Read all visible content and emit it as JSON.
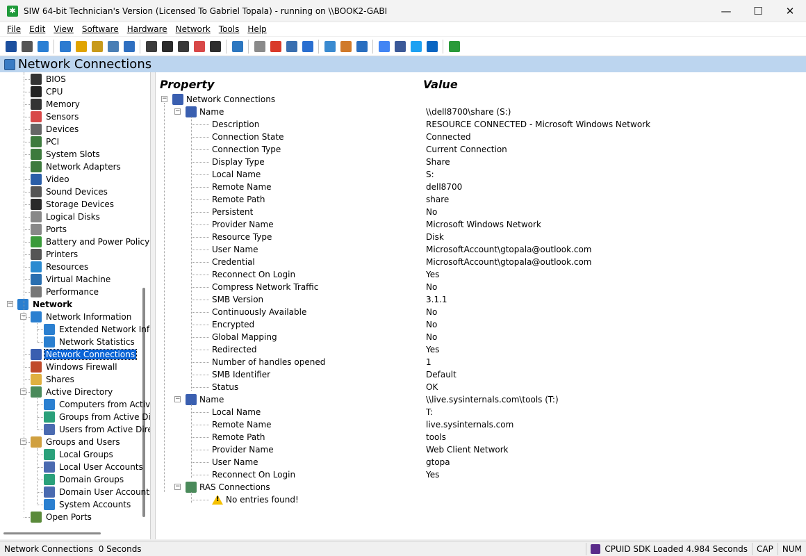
{
  "window": {
    "title": "SIW 64-bit Technician's Version (Licensed To Gabriel Topala) - running on \\\\BOOK2-GABI",
    "controls": {
      "minimize": "—",
      "maximize": "☐",
      "close": "✕"
    }
  },
  "menu": [
    "File",
    "Edit",
    "View",
    "Software",
    "Hardware",
    "Network",
    "Tools",
    "Help"
  ],
  "toolbar_icons": [
    {
      "name": "save-icon",
      "color": "#1c4f9e"
    },
    {
      "name": "print-icon",
      "color": "#555555"
    },
    {
      "name": "refresh-icon",
      "color": "#2a7fd4"
    },
    {
      "name": "sep"
    },
    {
      "name": "windows-icon",
      "color": "#2d7bd0"
    },
    {
      "name": "lock-icon",
      "color": "#e0a400"
    },
    {
      "name": "key-icon",
      "color": "#c89a1a"
    },
    {
      "name": "monitor-icon",
      "color": "#4a7fb5"
    },
    {
      "name": "shield-icon",
      "color": "#2f6fc0"
    },
    {
      "name": "sep"
    },
    {
      "name": "motherboard-icon",
      "color": "#3c3c3c"
    },
    {
      "name": "cpu-icon",
      "color": "#2b2b2b"
    },
    {
      "name": "memory-icon",
      "color": "#3a3a3a"
    },
    {
      "name": "sensor-icon",
      "color": "#d84848"
    },
    {
      "name": "disk-icon",
      "color": "#2e2e2e"
    },
    {
      "name": "sep"
    },
    {
      "name": "network-icon",
      "color": "#2d77c0"
    },
    {
      "name": "sep"
    },
    {
      "name": "eraser-icon",
      "color": "#8a8a8a"
    },
    {
      "name": "shutdown-icon",
      "color": "#d93a2a"
    },
    {
      "name": "password-icon",
      "color": "#3a6fb0"
    },
    {
      "name": "settings-icon",
      "color": "#2a6fd0"
    },
    {
      "name": "sep"
    },
    {
      "name": "update-icon",
      "color": "#3a8ad0"
    },
    {
      "name": "home-icon",
      "color": "#d07a2a"
    },
    {
      "name": "chat-icon",
      "color": "#2a6fc0"
    },
    {
      "name": "sep"
    },
    {
      "name": "google-icon",
      "color": "#4285f4"
    },
    {
      "name": "facebook-icon",
      "color": "#3b5998"
    },
    {
      "name": "twitter-icon",
      "color": "#1da1f2"
    },
    {
      "name": "linkedin-icon",
      "color": "#0a66c2"
    },
    {
      "name": "sep"
    },
    {
      "name": "dollar-icon",
      "color": "#2a9a3a"
    }
  ],
  "header": {
    "title": "Network Connections"
  },
  "tree": [
    {
      "label": "BIOS",
      "level": 2,
      "icon": "bios-icon",
      "color": "#333333",
      "y": 0
    },
    {
      "label": "CPU",
      "level": 2,
      "icon": "cpu-icon",
      "color": "#222222"
    },
    {
      "label": "Memory",
      "level": 2,
      "icon": "memory-icon",
      "color": "#333333"
    },
    {
      "label": "Sensors",
      "level": 2,
      "icon": "sensors-icon",
      "color": "#d84848"
    },
    {
      "label": "Devices",
      "level": 2,
      "icon": "devices-icon",
      "color": "#666666"
    },
    {
      "label": "PCI",
      "level": 2,
      "icon": "pci-icon",
      "color": "#3d7a3d"
    },
    {
      "label": "System Slots",
      "level": 2,
      "icon": "slots-icon",
      "color": "#3d7a3d"
    },
    {
      "label": "Network Adapters",
      "level": 2,
      "icon": "network-adapter-icon",
      "color": "#3d7a3d"
    },
    {
      "label": "Video",
      "level": 2,
      "icon": "video-icon",
      "color": "#2a5ea8"
    },
    {
      "label": "Sound Devices",
      "level": 2,
      "icon": "sound-icon",
      "color": "#555555"
    },
    {
      "label": "Storage Devices",
      "level": 2,
      "icon": "storage-icon",
      "color": "#2a2a2a"
    },
    {
      "label": "Logical Disks",
      "level": 2,
      "icon": "logical-disk-icon",
      "color": "#888888"
    },
    {
      "label": "Ports",
      "level": 2,
      "icon": "ports-icon",
      "color": "#888888"
    },
    {
      "label": "Battery and Power Policy",
      "level": 2,
      "icon": "battery-icon",
      "color": "#3a9a3a"
    },
    {
      "label": "Printers",
      "level": 2,
      "icon": "printer-icon",
      "color": "#555555"
    },
    {
      "label": "Resources",
      "level": 2,
      "icon": "resources-icon",
      "color": "#2a8ad0"
    },
    {
      "label": "Virtual Machine",
      "level": 2,
      "icon": "virtual-machine-icon",
      "color": "#2a6fb0"
    },
    {
      "label": "Performance",
      "level": 2,
      "icon": "performance-icon",
      "color": "#777777"
    },
    {
      "label": "Network",
      "level": 1,
      "icon": "network-icon",
      "color": "#2a7fd0",
      "bold": true,
      "expander": "−"
    },
    {
      "label": "Network Information",
      "level": 2,
      "icon": "network-info-icon",
      "color": "#2a7fd0",
      "expander": "−"
    },
    {
      "label": "Extended Network Info",
      "level": 3,
      "icon": "network-info-icon",
      "color": "#2a7fd0"
    },
    {
      "label": "Network Statistics",
      "level": 3,
      "icon": "network-stats-icon",
      "color": "#2a7fd0"
    },
    {
      "label": "Network Connections",
      "level": 2,
      "icon": "network-connections-icon",
      "color": "#3a5fb0",
      "selected": true
    },
    {
      "label": "Windows Firewall",
      "level": 2,
      "icon": "firewall-icon",
      "color": "#c04a2a"
    },
    {
      "label": "Shares",
      "level": 2,
      "icon": "shares-icon",
      "color": "#e0b040"
    },
    {
      "label": "Active Directory",
      "level": 2,
      "icon": "active-directory-icon",
      "color": "#4a8a5a",
      "expander": "−"
    },
    {
      "label": "Computers from Active Directory",
      "level": 3,
      "icon": "computers-icon",
      "color": "#2a7fd0"
    },
    {
      "label": "Groups from Active Directory",
      "level": 3,
      "icon": "groups-icon",
      "color": "#2aa07a"
    },
    {
      "label": "Users from Active Directory",
      "level": 3,
      "icon": "user-icon",
      "color": "#4a6ab0"
    },
    {
      "label": "Groups and Users",
      "level": 2,
      "icon": "groups-users-icon",
      "color": "#d0a040",
      "expander": "−"
    },
    {
      "label": "Local Groups",
      "level": 3,
      "icon": "groups-icon",
      "color": "#2aa07a"
    },
    {
      "label": "Local User Accounts",
      "level": 3,
      "icon": "user-icon",
      "color": "#4a6ab0"
    },
    {
      "label": "Domain Groups",
      "level": 3,
      "icon": "groups-icon",
      "color": "#2aa07a"
    },
    {
      "label": "Domain User Accounts",
      "level": 3,
      "icon": "user-icon",
      "color": "#4a6ab0"
    },
    {
      "label": "System Accounts",
      "level": 3,
      "icon": "system-accounts-icon",
      "color": "#2a7fd0"
    },
    {
      "label": "Open Ports",
      "level": 2,
      "icon": "open-ports-icon",
      "color": "#5a8a3a"
    }
  ],
  "columns": {
    "property": "Property",
    "value": "Value"
  },
  "properties": [
    {
      "label": "Network Connections",
      "value": "",
      "level": 0,
      "icon": "network-connections-icon",
      "expander": "−"
    },
    {
      "label": "Name",
      "value": "\\\\dell8700\\share (S:)",
      "level": 1,
      "icon": "network-drive-icon",
      "expander": "−"
    },
    {
      "label": "Description",
      "value": "RESOURCE CONNECTED - Microsoft Windows Network",
      "level": 2
    },
    {
      "label": "Connection State",
      "value": "Connected",
      "level": 2
    },
    {
      "label": "Connection Type",
      "value": "Current Connection",
      "level": 2
    },
    {
      "label": "Display Type",
      "value": "Share",
      "level": 2
    },
    {
      "label": "Local Name",
      "value": "S:",
      "level": 2
    },
    {
      "label": "Remote Name",
      "value": "dell8700",
      "level": 2
    },
    {
      "label": "Remote Path",
      "value": "share",
      "level": 2
    },
    {
      "label": "Persistent",
      "value": "No",
      "level": 2
    },
    {
      "label": "Provider Name",
      "value": "Microsoft Windows Network",
      "level": 2
    },
    {
      "label": "Resource Type",
      "value": "Disk",
      "level": 2
    },
    {
      "label": "User Name",
      "value": "MicrosoftAccount\\gtopala@outlook.com",
      "level": 2
    },
    {
      "label": "Credential",
      "value": "MicrosoftAccount\\gtopala@outlook.com",
      "level": 2
    },
    {
      "label": "Reconnect On Login",
      "value": "Yes",
      "level": 2
    },
    {
      "label": "Compress Network Traffic",
      "value": "No",
      "level": 2
    },
    {
      "label": "SMB Version",
      "value": "3.1.1",
      "level": 2
    },
    {
      "label": "Continuously Available",
      "value": "No",
      "level": 2
    },
    {
      "label": "Encrypted",
      "value": "No",
      "level": 2
    },
    {
      "label": "Global Mapping",
      "value": "No",
      "level": 2
    },
    {
      "label": "Redirected",
      "value": "Yes",
      "level": 2
    },
    {
      "label": "Number of handles opened",
      "value": "1",
      "level": 2
    },
    {
      "label": "SMB Identifier",
      "value": "Default",
      "level": 2
    },
    {
      "label": "Status",
      "value": "OK",
      "level": 2
    },
    {
      "label": "Name",
      "value": "\\\\live.sysinternals.com\\tools (T:)",
      "level": 1,
      "icon": "network-drive-icon",
      "expander": "−"
    },
    {
      "label": "Local Name",
      "value": "T:",
      "level": 2
    },
    {
      "label": "Remote Name",
      "value": "live.sysinternals.com",
      "level": 2
    },
    {
      "label": "Remote Path",
      "value": "tools",
      "level": 2
    },
    {
      "label": "Provider Name",
      "value": "Web Client Network",
      "level": 2
    },
    {
      "label": "User Name",
      "value": "gtopa",
      "level": 2
    },
    {
      "label": "Reconnect On Login",
      "value": "Yes",
      "level": 2
    },
    {
      "label": "RAS Connections",
      "value": "",
      "level": 1,
      "icon": "ras-icon",
      "expander": "−"
    },
    {
      "label": "No entries found!",
      "value": "",
      "level": 2,
      "icon": "warning-icon"
    }
  ],
  "statusbar": {
    "left": "Network Connections  0 Seconds",
    "cpuid": "CPUID SDK Loaded 4.984 Seconds",
    "cap": "CAP",
    "num": "NUM"
  }
}
